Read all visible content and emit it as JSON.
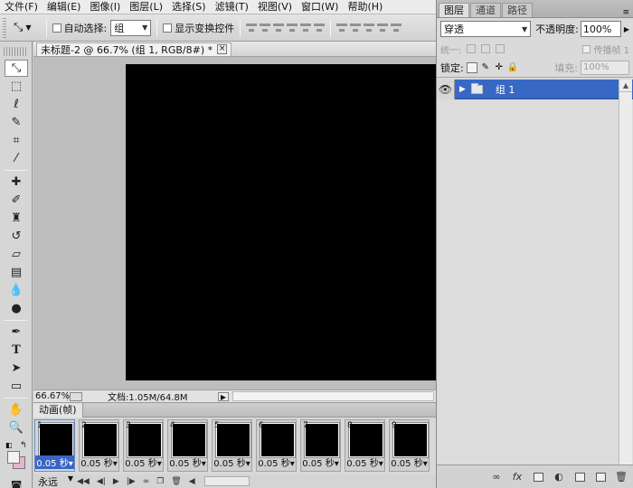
{
  "menu": [
    "文件(F)",
    "编辑(E)",
    "图像(I)",
    "图层(L)",
    "选择(S)",
    "滤镜(T)",
    "视图(V)",
    "窗口(W)",
    "帮助(H)"
  ],
  "options": {
    "auto_select_label": "自动选择:",
    "auto_select_value": "组",
    "show_transform_label": "显示变换控件"
  },
  "document": {
    "tab_title": "未标题-2 @ 66.7% (组 1, RGB/8#) *",
    "close_glyph": "⊠"
  },
  "status": {
    "zoom": "66.67%",
    "doc_info": "文档:1.05M/64.8M"
  },
  "animation": {
    "tab_label": "动画(帧)",
    "frames": [
      {
        "num": "1",
        "delay": "0.05 秒▾"
      },
      {
        "num": "2",
        "delay": "0.05 秒▾"
      },
      {
        "num": "3",
        "delay": "0.05 秒▾"
      },
      {
        "num": "4",
        "delay": "0.05 秒▾"
      },
      {
        "num": "5",
        "delay": "0.05 秒▾"
      },
      {
        "num": "6",
        "delay": "0.05 秒▾"
      },
      {
        "num": "7",
        "delay": "0.05 秒▾"
      },
      {
        "num": "8",
        "delay": "0.05 秒▾"
      },
      {
        "num": "9",
        "delay": "0.05 秒▾"
      }
    ],
    "loop_value": "永远"
  },
  "layers_panel": {
    "tabs": [
      "图层",
      "通道",
      "路径"
    ],
    "blend_mode": "穿透",
    "opacity_label": "不透明度:",
    "opacity_value": "100%",
    "unify_label": "统一:",
    "propagate_label": "传播帧 1",
    "lock_label": "锁定:",
    "fill_label": "填充:",
    "fill_value": "100%",
    "layers": [
      {
        "name": "组 1",
        "selected": true
      }
    ]
  },
  "colors": {
    "accent": "#3768c4",
    "canvas": "#000000",
    "background_swatch": "#e6b4d2",
    "foreground_swatch": "#f2f2f2"
  }
}
